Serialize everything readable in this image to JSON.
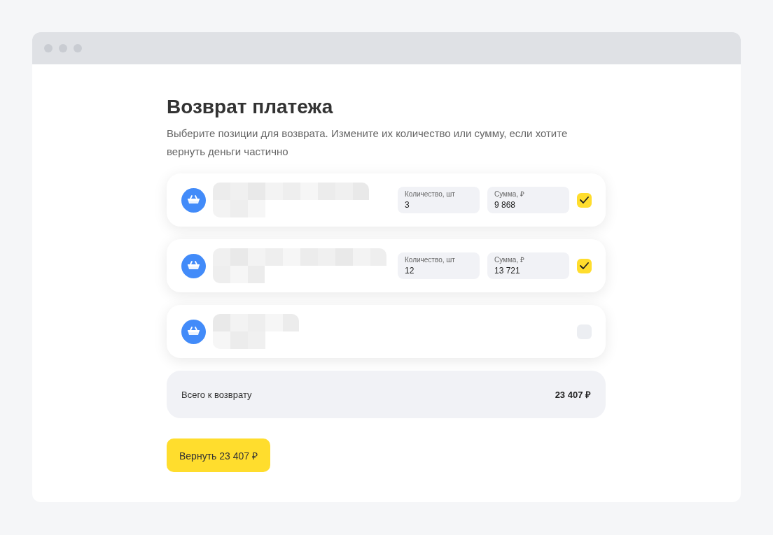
{
  "title": "Возврат платежа",
  "subtitle": "Выберите позиции для возврата. Измените их количество или сумму, если хотите вернуть деньги частично",
  "items": [
    {
      "checked": true,
      "fields": [
        {
          "label": "Количество, шт",
          "value": "3"
        },
        {
          "label": "Сумма, ₽",
          "value": "9 868"
        }
      ]
    },
    {
      "checked": true,
      "fields": [
        {
          "label": "Количество, шт",
          "value": "12"
        },
        {
          "label": "Сумма, ₽",
          "value": "13 721"
        }
      ]
    },
    {
      "checked": false
    }
  ],
  "total": {
    "label": "Всего к возврату",
    "value": "23 407 ₽"
  },
  "button": "Вернуть 23 407 ₽"
}
